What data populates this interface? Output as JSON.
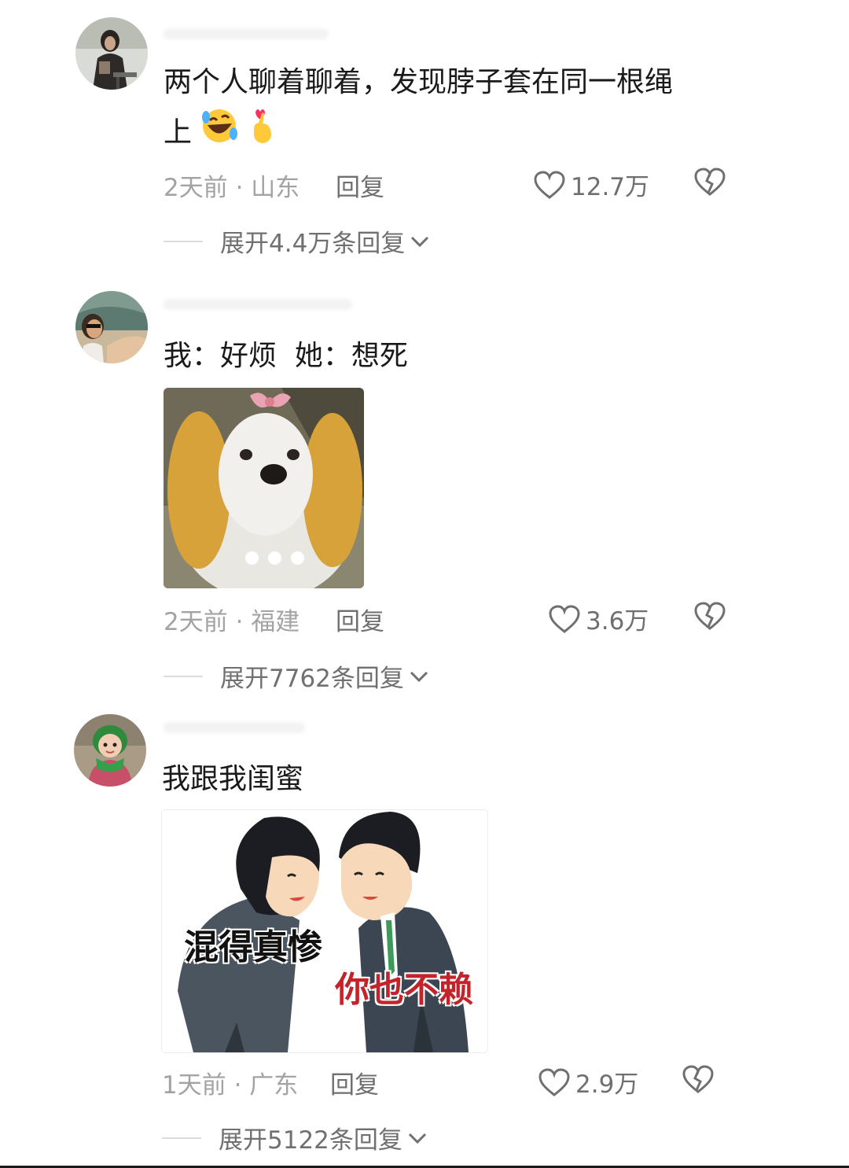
{
  "comments": [
    {
      "text": "两个人聊着聊着，发现脖子套在同一根绳",
      "text_line2": "上",
      "emojis": [
        "rolling-laughing-emoji",
        "finger-heart-emoji"
      ],
      "meta": "2天前 · 山东",
      "reply_label": "回复",
      "likes": "12.7万",
      "expand_label": "展开4.4万条回复"
    },
    {
      "text": "我：好烦  她：想死",
      "image": "dog-with-yellow-ears-meme",
      "meta": "2天前 · 福建",
      "reply_label": "回复",
      "likes": "3.6万",
      "expand_label": "展开7762条回复"
    },
    {
      "text": "我跟我闺蜜",
      "image": "two-office-workers-bowing-meme",
      "meme_caption_left": "混得真惨",
      "meme_caption_right": "你也不赖",
      "meta": "1天前 · 广东",
      "reply_label": "回复",
      "likes": "2.9万",
      "expand_label": "展开5122条回复"
    }
  ],
  "icons": {
    "like": "heart-outline-icon",
    "dislike": "broken-heart-icon",
    "expand": "chevron-down-icon"
  },
  "colors": {
    "text": "#1a1a1a",
    "meta": "#a3a3a3",
    "action": "#6f6f6f",
    "meme_red": "#c3232a"
  }
}
